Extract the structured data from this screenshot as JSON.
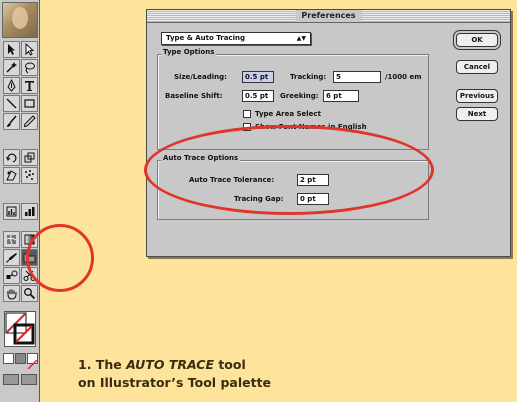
{
  "dialog": {
    "title": "Preferences",
    "section_popup": "Type & Auto Tracing",
    "type_options": {
      "title": "Type Options",
      "size_leading_label": "Size/Leading:",
      "size_leading_value": "0.5 pt",
      "tracking_label": "Tracking:",
      "tracking_value": "5",
      "tracking_unit": "/1000 em",
      "baseline_shift_label": "Baseline Shift:",
      "baseline_shift_value": "0.5 pt",
      "greeking_label": "Greeking:",
      "greeking_value": "6 pt",
      "type_area_select_label": "Type Area Select",
      "show_font_names_label": "Show Font Names in English"
    },
    "auto_trace_options": {
      "title": "Auto Trace Options",
      "tolerance_label": "Auto Trace Tolerance:",
      "tolerance_value": "2 pt",
      "tracing_gap_label": "Tracing Gap:",
      "tracing_gap_value": "0 pt"
    },
    "buttons": {
      "ok": "OK",
      "cancel": "Cancel",
      "previous": "Previous",
      "next": "Next"
    }
  },
  "caption": {
    "line1_prefix": "1. The ",
    "line1_tool": "AUTO TRACE",
    "line1_suffix": " tool",
    "line2": "on Illustrator’s Tool palette"
  },
  "colors": {
    "background": "#fde49a",
    "highlight": "#e0352b",
    "dialog": "#c8c8c8"
  }
}
